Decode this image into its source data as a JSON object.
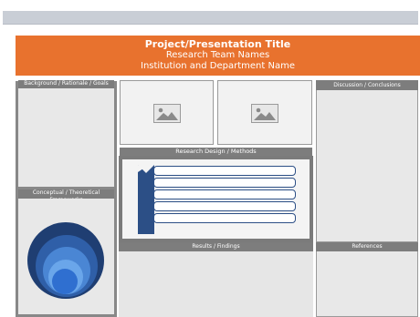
{
  "header": {
    "title": "Project/Presentation Title",
    "team": "Research Team Names",
    "institution": "Institution and Department Name"
  },
  "sections": {
    "background": "Background / Rationale / Goals",
    "frameworks": "Conceptual / Theoretical Frameworks",
    "methods": "Research Design / Methods",
    "results": "Results / Findings",
    "discussion": "Discussion / Conclusions",
    "references": "References"
  },
  "colors": {
    "accent": "#e8722e",
    "header_gray": "#7d7d7d",
    "panel_gray": "#e8e8e8",
    "navy": "#2c4f86"
  },
  "icons": [
    "image-placeholder-icon",
    "image-placeholder-icon",
    "chevron-arrow-icon",
    "concentric-circles-icon"
  ]
}
